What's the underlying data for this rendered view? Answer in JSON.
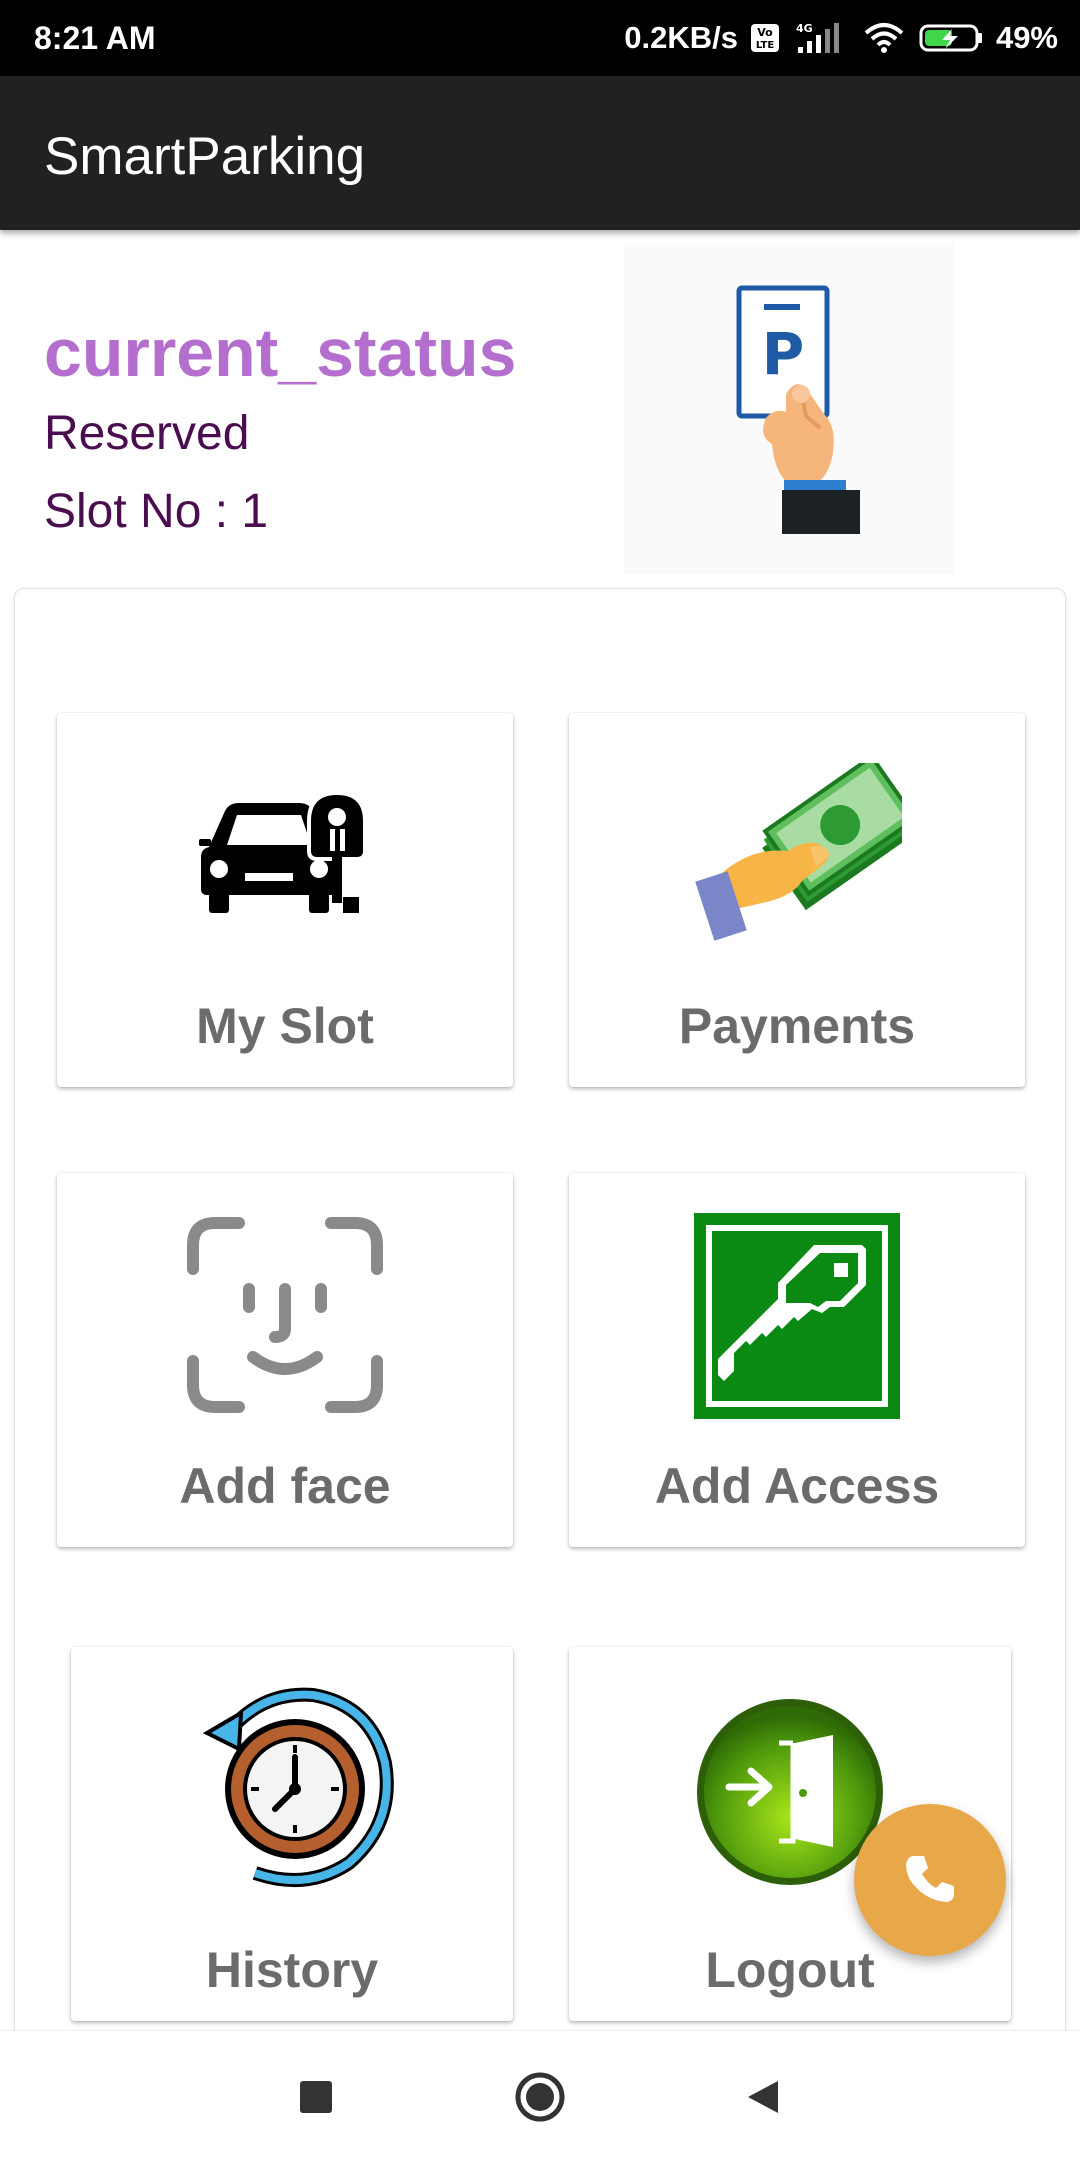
{
  "status_bar": {
    "time": "8:21 AM",
    "network_speed": "0.2KB/s",
    "volte_badge": "VoLTE",
    "network_type": "4G",
    "battery": "49%",
    "icons": [
      "volte-icon",
      "signal-icon",
      "wifi-icon",
      "battery-charging-icon"
    ]
  },
  "app_bar": {
    "title": "SmartParking"
  },
  "status": {
    "title": "current_status",
    "value": "Reserved",
    "slot": "Slot No : 1",
    "illustration": "parking-ticket-hand"
  },
  "menu": {
    "items": [
      {
        "label": "My Slot",
        "icon": "car-parking-meter-icon"
      },
      {
        "label": "Payments",
        "icon": "money-hand-icon"
      },
      {
        "label": "Add face",
        "icon": "face-id-icon"
      },
      {
        "label": "Add Access",
        "icon": "key-icon"
      },
      {
        "label": "History",
        "icon": "clock-history-icon"
      },
      {
        "label": "Logout",
        "icon": "logout-door-icon"
      }
    ]
  },
  "fab": {
    "icon": "phone-icon"
  },
  "nav": {
    "icons": [
      "recents-icon",
      "home-icon",
      "back-icon"
    ]
  },
  "colors": {
    "status_title": "#b46fce",
    "status_text": "#4a0e50",
    "app_bar": "#212121",
    "fab": "#e8a84a",
    "tile_label": "#6b6b6b"
  }
}
